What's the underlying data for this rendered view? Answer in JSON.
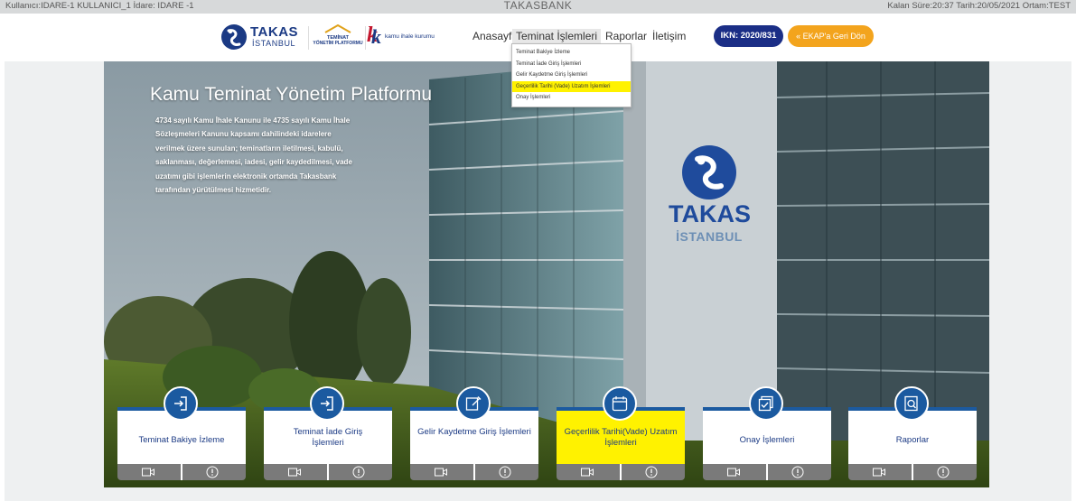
{
  "statusbar": {
    "left": "Kullanıcı:IDARE-1 KULLANICI_1  İdare: IDARE -1",
    "center": "TAKASBANK",
    "right": "Kalan Süre:20:37  Tarih:20/05/2021  Ortam:TEST"
  },
  "logos": {
    "takas_line1": "TAKAS",
    "takas_line2": "İSTANBUL",
    "typ_line1": "TEMİNAT",
    "typ_line2": "YÖNETİM PLATFORMU",
    "kik_text": "kamu ihale kurumu"
  },
  "nav": {
    "home": "Anasayfa",
    "teminat": "Teminat İşlemleri",
    "reports": "Raporlar",
    "contact": "İletişim",
    "ikn_button": "IKN: 2020/831",
    "ekap_button": "« EKAP'a Geri Dön"
  },
  "dropdown": {
    "items": [
      "Teminat Bakiye İzleme",
      "Teminat İade Giriş İşlemleri",
      "Gelir Kaydetme Giriş İşlemleri",
      "Geçerlilik Tarihi (Vade) Uzatım İşlemleri",
      "Onay İşlemleri"
    ],
    "highlighted_index": 3
  },
  "hero": {
    "title": "Kamu Teminat Yönetim Platformu",
    "text": "4734 sayılı Kamu İhale Kanunu ile 4735 sayılı Kamu İhale Sözleşmeleri Kanunu kapsamı dahilindeki idarelere verilmek üzere sunulan; teminatların iletilmesi, kabulü, saklanması, değerlemesi, iadesi, gelir kaydedilmesi, vade uzatımı gibi işlemlerin elektronik ortamda Takasbank tarafından yürütülmesi hizmetidir.",
    "logo_line1": "TAKAS",
    "logo_line2": "İSTANBUL"
  },
  "cards": [
    {
      "label": "Teminat Bakiye İzleme",
      "icon": "login-arrow-icon"
    },
    {
      "label": "Teminat İade Giriş İşlemleri",
      "icon": "login-arrow-icon"
    },
    {
      "label": "Gelir Kaydetme Giriş İşlemleri",
      "icon": "edit-icon"
    },
    {
      "label": "Geçerlilik Tarihi(Vade) Uzatım İşlemleri",
      "icon": "calendar-icon"
    },
    {
      "label": "Onay İşlemleri",
      "icon": "approve-doc-icon"
    },
    {
      "label": "Raporlar",
      "icon": "report-search-icon"
    }
  ],
  "colors": {
    "brand_blue": "#1b5aa0",
    "navy": "#1b2e86",
    "ekap_orange": "#f3a41d",
    "highlight_yellow": "#fff200"
  }
}
